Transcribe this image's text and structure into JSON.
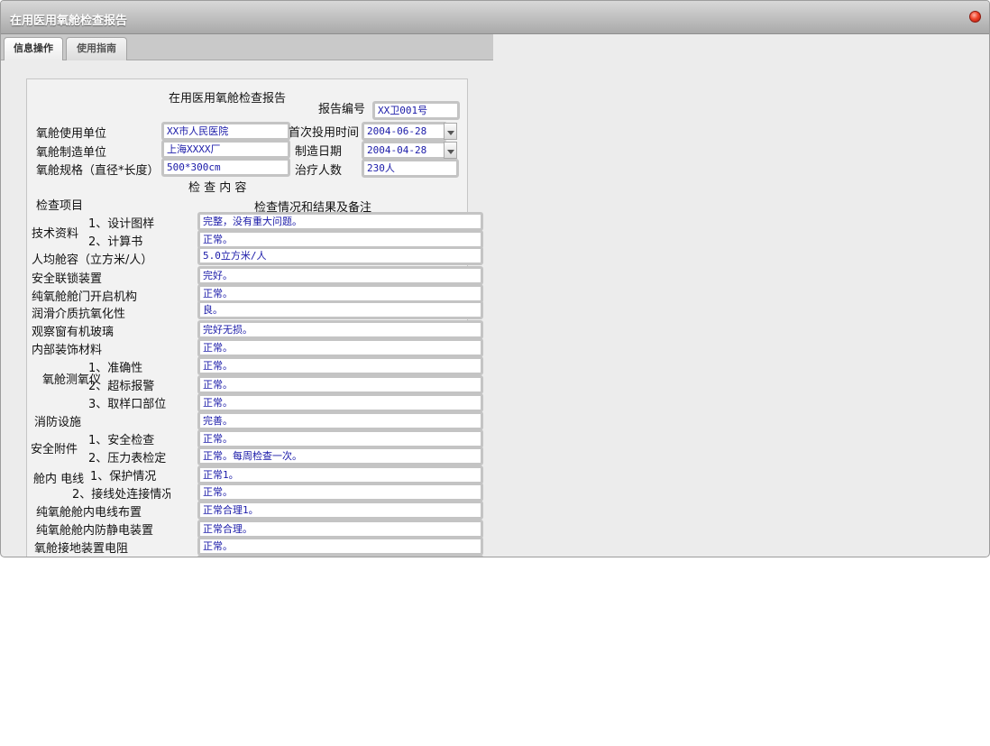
{
  "window": {
    "title": "在用医用氧舱检查报告"
  },
  "tabs": [
    {
      "label": "信息操作"
    },
    {
      "label": "使用指南"
    }
  ],
  "form": {
    "heading": "在用医用氧舱检查报告",
    "report_no_label": "报告编号",
    "report_no": "XX卫001号",
    "user_unit_label": "氧舱使用单位",
    "user_unit": "XX市人民医院",
    "first_use_label": "首次投用时间",
    "first_use": "2004-06-28",
    "maker_label": "氧舱制造单位",
    "maker": "上海XXXX厂",
    "make_date_label": "制造日期",
    "make_date": "2004-04-28",
    "spec_label": "氧舱规格（直径*长度）",
    "spec": "500*300cm",
    "patients_label": "治疗人数",
    "patients": "230人",
    "section_title": "检 查 内 容",
    "col_item": "检查项目",
    "col_result": "检查情况和结果及备注",
    "tech_docs": "技术资料",
    "tech_1": "1、设计图样",
    "tech_1_value": "完整，没有重大问题。",
    "tech_2": "2、计算书",
    "tech_2_value": "正常。",
    "capacity": "人均舱容（立方米/人）",
    "capacity_value": "5.0立方米/人",
    "interlock": "安全联锁装置",
    "interlock_value": "完好。",
    "door": "纯氧舱舱门开启机构",
    "door_value": "正常。",
    "lube": "润滑介质抗氧化性",
    "lube_value": "良。",
    "window_glass": "观察窗有机玻璃",
    "window_glass_value": "完好无损。",
    "decor": "内部装饰材料",
    "decor_value": "正常。",
    "oxy_meter": "氧舱测氧仪",
    "oxy_1": "1、准确性",
    "oxy_1_value": "正常。",
    "oxy_2": "2、超标报警",
    "oxy_2_value": "正常。",
    "oxy_3": "3、取样口部位",
    "oxy_3_value": "正常。",
    "fire": "消防设施",
    "fire_value": "完善。",
    "safety": "安全附件",
    "safety_1": "1、安全检查",
    "safety_1_value": "正常。",
    "safety_2": "2、压力表检定",
    "safety_2_value": "正常。每周检查一次。",
    "wire": "舱内 电线",
    "wire_1": "1、保护情况",
    "wire_1_value": "正常1。",
    "wire_2": "2、接线处连接情况",
    "wire_2_value": "正常。",
    "wire_layout": "纯氧舱舱内电线布置",
    "wire_layout_value": "正常合理1。",
    "antistatic": "纯氧舱舱内防静电装置",
    "antistatic_value": "正常合理。",
    "ground": "氧舱接地装置电阻",
    "ground_value": "正常。"
  }
}
